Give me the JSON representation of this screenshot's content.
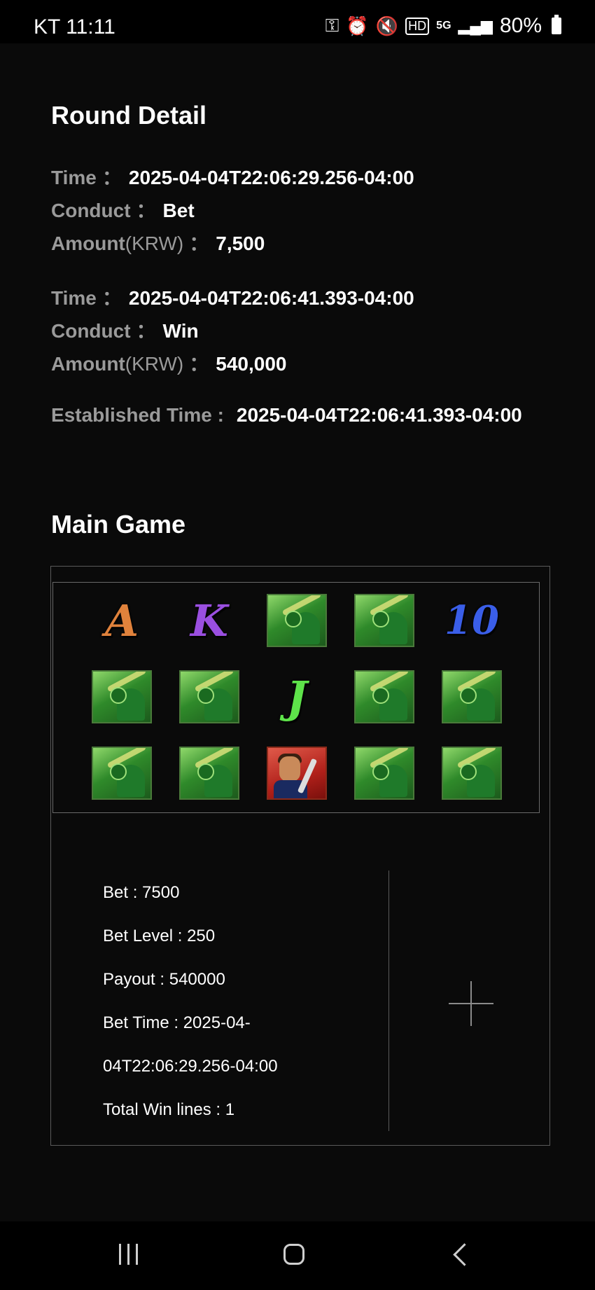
{
  "status_bar": {
    "carrier_time": "KT 11:11",
    "battery": "80%",
    "icons": [
      "key-icon",
      "alarm-icon",
      "mute-icon",
      "hd-icon",
      "5g-icon",
      "signal-icon",
      "battery-icon"
    ]
  },
  "round_detail": {
    "title": "Round Detail",
    "entries": [
      {
        "time_label": "Time",
        "time": "2025-04-04T22:06:29.256-04:00",
        "conduct_label": "Conduct",
        "conduct": "Bet",
        "amount_label": "Amount",
        "amount_unit": "(KRW)",
        "amount": "7,500"
      },
      {
        "time_label": "Time",
        "time": "2025-04-04T22:06:41.393-04:00",
        "conduct_label": "Conduct",
        "conduct": "Win",
        "amount_label": "Amount",
        "amount_unit": "(KRW)",
        "amount": "540,000"
      }
    ],
    "established_label": "Established Time :",
    "established_time": "2025-04-04T22:06:41.393-04:00",
    "colon": "："
  },
  "main_game": {
    "title": "Main Game",
    "reels": [
      [
        "A",
        "K",
        "batsman",
        "batsman",
        "10"
      ],
      [
        "batsman",
        "batsman",
        "J",
        "batsman",
        "batsman"
      ],
      [
        "batsman",
        "batsman",
        "captain",
        "batsman",
        "batsman"
      ]
    ],
    "info": {
      "bet": "Bet : 7500",
      "bet_level": "Bet Level : 250",
      "payout": "Payout : 540000",
      "bet_time_line1": "Bet Time : 2025-04-",
      "bet_time_line2": "04T22:06:29.256-04:00",
      "total_win_lines": "Total Win lines : 1"
    }
  }
}
